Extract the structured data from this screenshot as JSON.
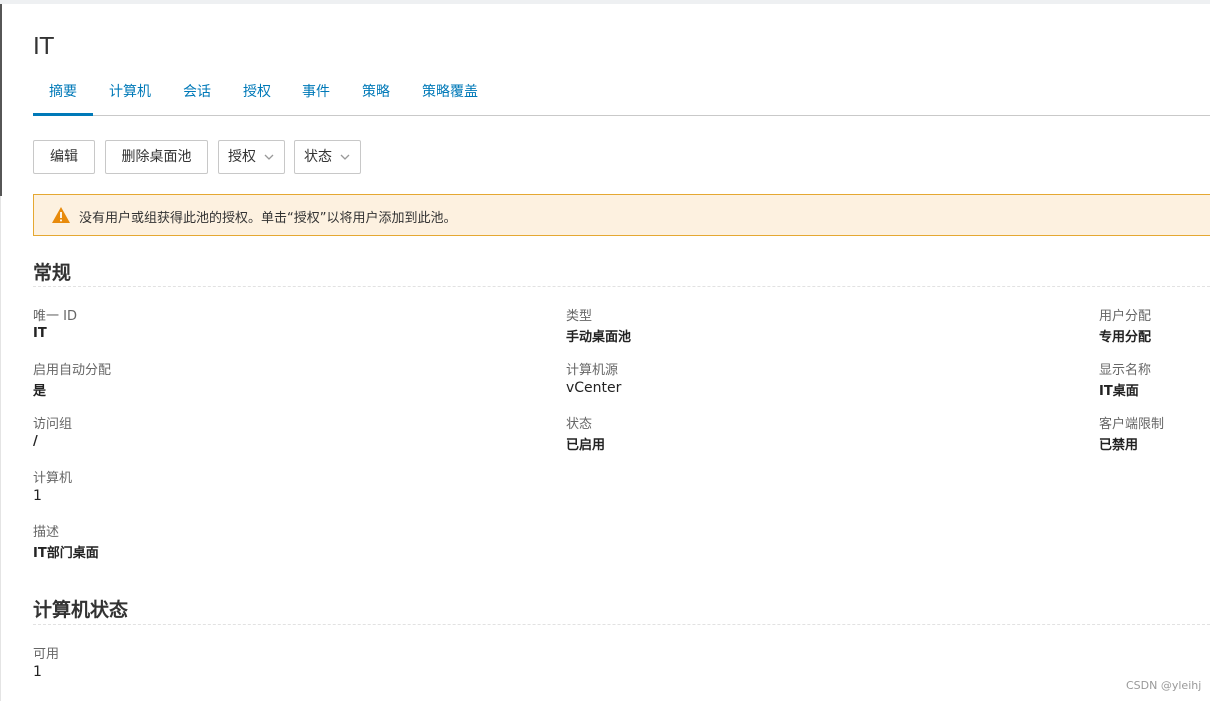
{
  "page": {
    "title": "IT"
  },
  "tabs": [
    {
      "label": "摘要",
      "active": true
    },
    {
      "label": "计算机"
    },
    {
      "label": "会话"
    },
    {
      "label": "授权"
    },
    {
      "label": "事件"
    },
    {
      "label": "策略"
    },
    {
      "label": "策略覆盖"
    }
  ],
  "toolbar": {
    "edit": "编辑",
    "delete_pool": "删除桌面池",
    "entitlements": "授权",
    "status": "状态"
  },
  "alert": {
    "icon": "warning-icon",
    "text": "没有用户或组获得此池的授权。单击“授权”以将用户添加到此池。",
    "border_color": "#e5a832",
    "background": "#fdf1e0"
  },
  "general": {
    "title": "常规",
    "unique_id": {
      "label": "唯一 ID",
      "value": "IT"
    },
    "type": {
      "label": "类型",
      "value": "手动桌面池"
    },
    "user_assignment": {
      "label": "用户分配",
      "value": "专用分配"
    },
    "auto_assign": {
      "label": "启用自动分配",
      "value": "是"
    },
    "machine_source": {
      "label": "计算机源",
      "value": "vCenter"
    },
    "display_name": {
      "label": "显示名称",
      "value": "IT桌面"
    },
    "access_group": {
      "label": "访问组",
      "value": "/"
    },
    "state": {
      "label": "状态",
      "value": "已启用"
    },
    "client_restrictions": {
      "label": "客户端限制",
      "value": "已禁用"
    },
    "machines": {
      "label": "计算机",
      "value": "1"
    },
    "description": {
      "label": "描述",
      "value": "IT部门桌面"
    }
  },
  "machine_status": {
    "title": "计算机状态",
    "available": {
      "label": "可用",
      "value": "1"
    }
  },
  "watermark": "CSDN @yleihj",
  "colors": {
    "accent": "#0079b8",
    "text": "#333333"
  }
}
